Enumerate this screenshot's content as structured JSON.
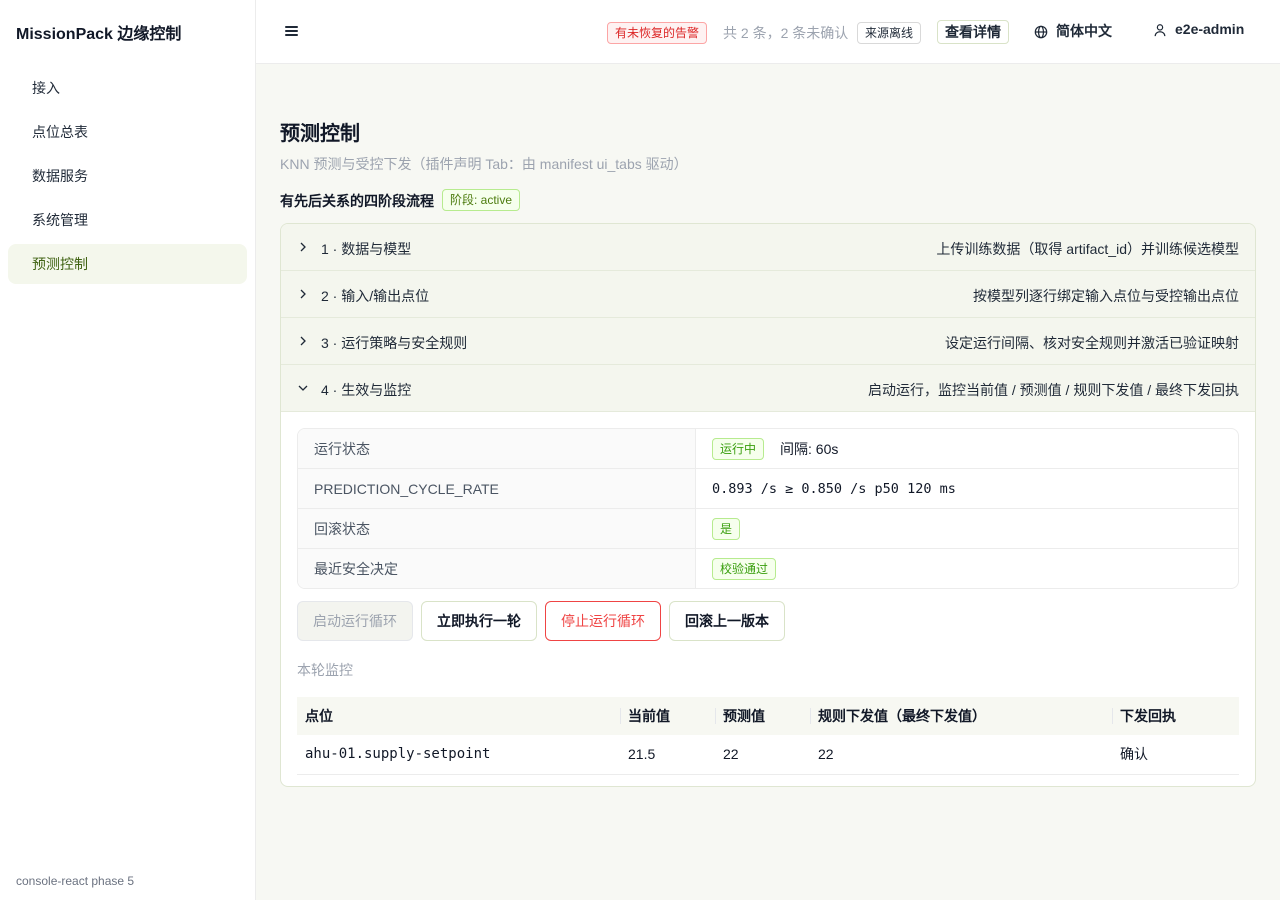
{
  "app": {
    "brand": "MissionPack 边缘控制",
    "footer": "console-react phase 5"
  },
  "sidebar": {
    "items": [
      {
        "label": "接入"
      },
      {
        "label": "点位总表"
      },
      {
        "label": "数据服务"
      },
      {
        "label": "系统管理"
      },
      {
        "label": "预测控制",
        "active": true
      }
    ]
  },
  "topbar": {
    "alert_tag": "有未恢复的告警",
    "alert_count": "共 2 条，2 条未确认",
    "offline_tag": "来源离线",
    "details_label": "查看详情",
    "language": "简体中文",
    "user": "e2e-admin",
    "icons": {
      "menu": "menu-icon",
      "language": "globe-icon",
      "user": "user-icon"
    }
  },
  "page": {
    "title": "预测控制",
    "subtitle": "KNN 预测与受控下发（插件声明 Tab：由 manifest ui_tabs 驱动）",
    "flow_title": "有先后关系的四阶段流程",
    "phase_tag": "阶段: active"
  },
  "panels": [
    {
      "title": "1 · 数据与模型",
      "extra": "上传训练数据（取得 artifact_id）并训练候选模型",
      "expanded": false
    },
    {
      "title": "2 · 输入/输出点位",
      "extra": "按模型列逐行绑定输入点位与受控输出点位",
      "expanded": false
    },
    {
      "title": "3 · 运行策略与安全规则",
      "extra": "设定运行间隔、核对安全规则并激活已验证映射",
      "expanded": false
    },
    {
      "title": "4 · 生效与监控",
      "extra": "启动运行，监控当前值 / 预测值 / 规则下发值 / 最终下发回执",
      "expanded": true
    }
  ],
  "status": {
    "run_state_label": "运行状态",
    "run_state_tag": "运行中",
    "interval": "间隔: 60s",
    "rate_label": "PREDICTION_CYCLE_RATE",
    "rate_value": "0.893 /s ≥ 0.850 /s p50 120 ms",
    "rollback_label": "回滚状态",
    "rollback_tag": "是",
    "safety_label": "最近安全决定",
    "safety_tag": "校验通过"
  },
  "actions": {
    "start": "启动运行循环",
    "run_once": "立即执行一轮",
    "stop": "停止运行循环",
    "rollback": "回滚上一版本"
  },
  "monitor": {
    "title": "本轮监控",
    "columns": [
      "点位",
      "当前值",
      "预测值",
      "规则下发值（最终下发值）",
      "下发回执"
    ],
    "rows": [
      [
        "ahu-01.supply-setpoint",
        "21.5",
        "22",
        "22",
        "确认"
      ]
    ]
  }
}
